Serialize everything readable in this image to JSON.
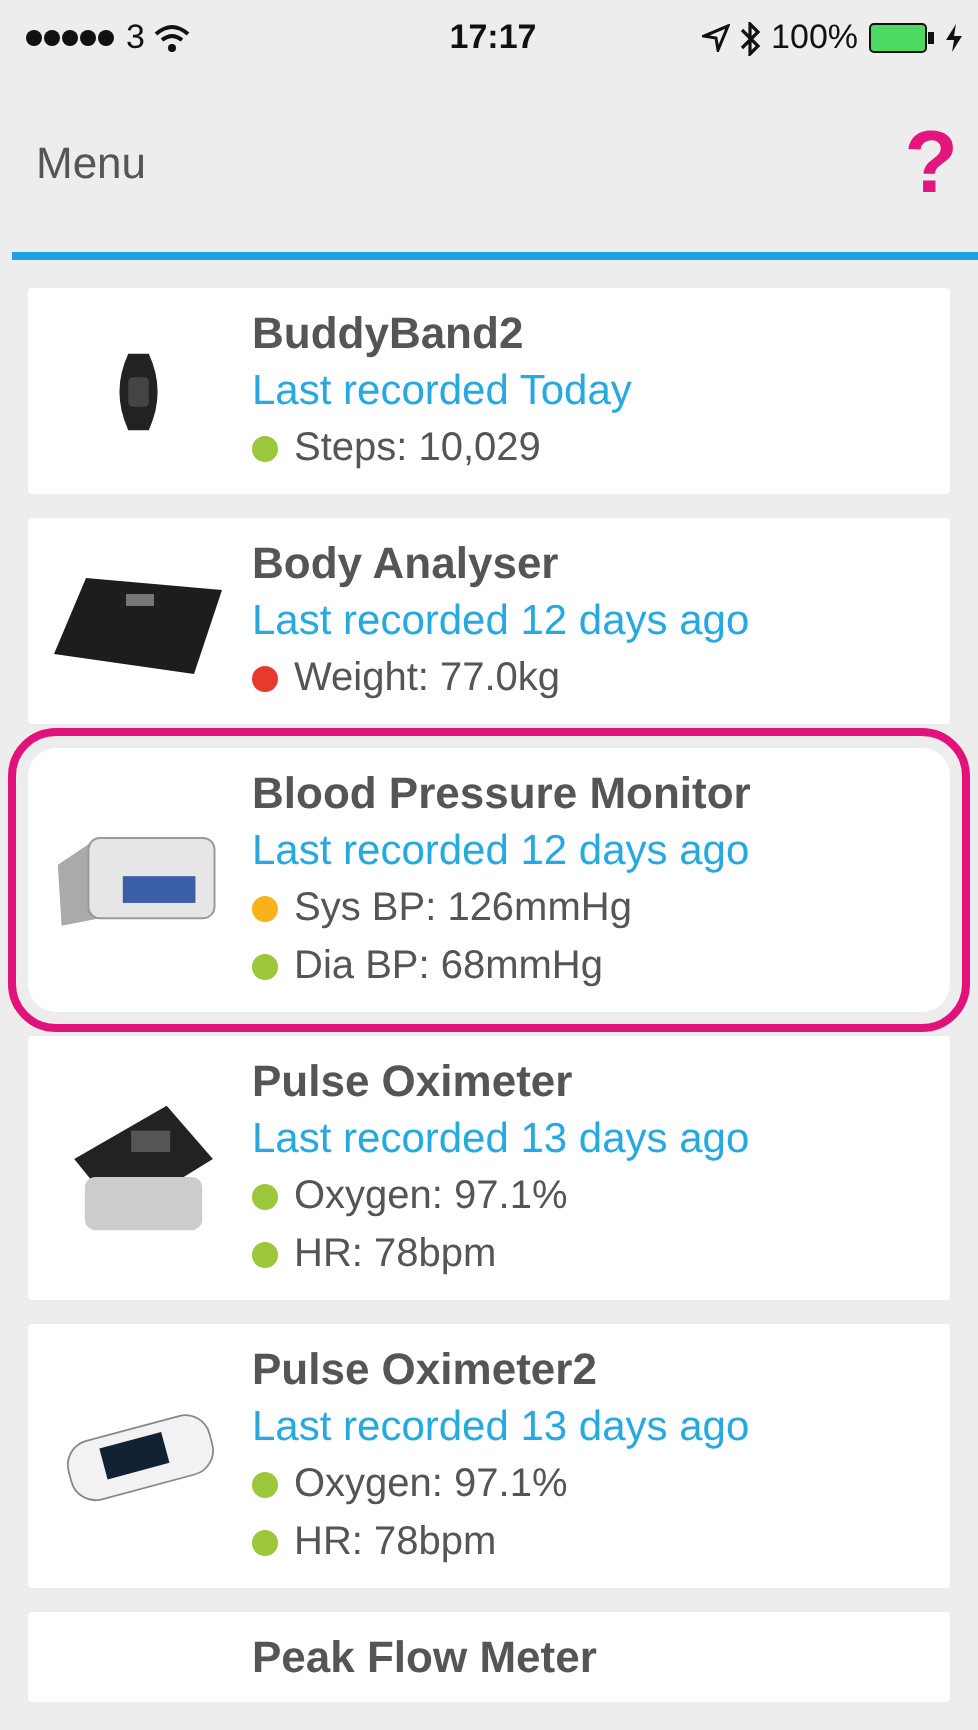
{
  "status_bar": {
    "carrier": "3",
    "time": "17:17",
    "battery": "100%"
  },
  "nav": {
    "title": "Menu",
    "help": "?"
  },
  "devices": [
    {
      "kind": "band",
      "name": "BuddyBand2",
      "last_recorded": "Last recorded Today",
      "highlighted": false,
      "readings": [
        {
          "text": "Steps: 10,029",
          "color": "#9cc73a"
        }
      ]
    },
    {
      "kind": "scale",
      "name": "Body Analyser",
      "last_recorded": "Last recorded 12 days ago",
      "highlighted": false,
      "readings": [
        {
          "text": "Weight: 77.0kg",
          "color": "#e8392f"
        }
      ]
    },
    {
      "kind": "bp",
      "name": "Blood Pressure Monitor",
      "last_recorded": "Last recorded 12 days ago",
      "highlighted": true,
      "readings": [
        {
          "text": "Sys BP: 126mmHg",
          "color": "#f7b21c"
        },
        {
          "text": "Dia BP: 68mmHg",
          "color": "#9cc73a"
        }
      ]
    },
    {
      "kind": "oximeter",
      "name": "Pulse Oximeter",
      "last_recorded": "Last recorded 13 days ago",
      "highlighted": false,
      "readings": [
        {
          "text": "Oxygen: 97.1%",
          "color": "#9cc73a"
        },
        {
          "text": "HR: 78bpm",
          "color": "#9cc73a"
        }
      ]
    },
    {
      "kind": "oximeter2",
      "name": "Pulse Oximeter2",
      "last_recorded": "Last recorded 13 days ago",
      "highlighted": false,
      "readings": [
        {
          "text": "Oxygen: 97.1%",
          "color": "#9cc73a"
        },
        {
          "text": "HR: 78bpm",
          "color": "#9cc73a"
        }
      ]
    },
    {
      "name": "Peak Flow Meter",
      "highlighted": false
    }
  ]
}
